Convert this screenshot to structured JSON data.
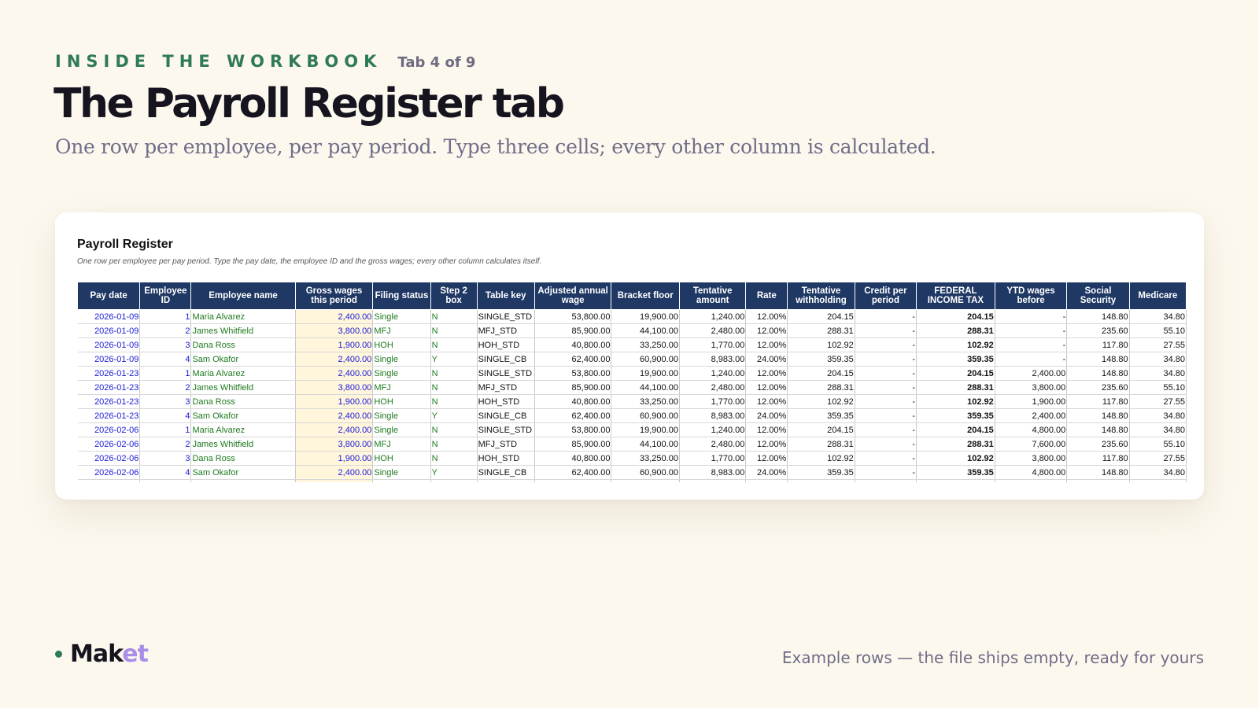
{
  "header": {
    "eyebrow": "INSIDE THE WORKBOOK",
    "tab_info": "Tab 4 of 9",
    "title": "The Payroll Register tab",
    "subtitle": "One row per employee, per pay period. Type three cells; every other column is calculated."
  },
  "sheet": {
    "title": "Payroll Register",
    "note": "One row per employee per pay period. Type the pay date, the employee ID and the gross wages; every other column calculates itself.",
    "columns": [
      "Pay date",
      "Employee ID",
      "Employee name",
      "Gross wages this period",
      "Filing status",
      "Step 2 box",
      "Table key",
      "Adjusted annual wage",
      "Bracket floor",
      "Tentative amount",
      "Rate",
      "Tentative withholding",
      "Credit per period",
      "FEDERAL INCOME TAX",
      "YTD wages before",
      "Social Security",
      "Medicare"
    ],
    "rows": [
      [
        "2026-01-09",
        "1",
        "Maria Alvarez",
        "2,400.00",
        "Single",
        "N",
        "SINGLE_STD",
        "53,800.00",
        "19,900.00",
        "1,240.00",
        "12.00%",
        "204.15",
        "-",
        "204.15",
        "-",
        "148.80",
        "34.80"
      ],
      [
        "2026-01-09",
        "2",
        "James Whitfield",
        "3,800.00",
        "MFJ",
        "N",
        "MFJ_STD",
        "85,900.00",
        "44,100.00",
        "2,480.00",
        "12.00%",
        "288.31",
        "-",
        "288.31",
        "-",
        "235.60",
        "55.10"
      ],
      [
        "2026-01-09",
        "3",
        "Dana Ross",
        "1,900.00",
        "HOH",
        "N",
        "HOH_STD",
        "40,800.00",
        "33,250.00",
        "1,770.00",
        "12.00%",
        "102.92",
        "-",
        "102.92",
        "-",
        "117.80",
        "27.55"
      ],
      [
        "2026-01-09",
        "4",
        "Sam Okafor",
        "2,400.00",
        "Single",
        "Y",
        "SINGLE_CB",
        "62,400.00",
        "60,900.00",
        "8,983.00",
        "24.00%",
        "359.35",
        "-",
        "359.35",
        "-",
        "148.80",
        "34.80"
      ],
      [
        "2026-01-23",
        "1",
        "Maria Alvarez",
        "2,400.00",
        "Single",
        "N",
        "SINGLE_STD",
        "53,800.00",
        "19,900.00",
        "1,240.00",
        "12.00%",
        "204.15",
        "-",
        "204.15",
        "2,400.00",
        "148.80",
        "34.80"
      ],
      [
        "2026-01-23",
        "2",
        "James Whitfield",
        "3,800.00",
        "MFJ",
        "N",
        "MFJ_STD",
        "85,900.00",
        "44,100.00",
        "2,480.00",
        "12.00%",
        "288.31",
        "-",
        "288.31",
        "3,800.00",
        "235.60",
        "55.10"
      ],
      [
        "2026-01-23",
        "3",
        "Dana Ross",
        "1,900.00",
        "HOH",
        "N",
        "HOH_STD",
        "40,800.00",
        "33,250.00",
        "1,770.00",
        "12.00%",
        "102.92",
        "-",
        "102.92",
        "1,900.00",
        "117.80",
        "27.55"
      ],
      [
        "2026-01-23",
        "4",
        "Sam Okafor",
        "2,400.00",
        "Single",
        "Y",
        "SINGLE_CB",
        "62,400.00",
        "60,900.00",
        "8,983.00",
        "24.00%",
        "359.35",
        "-",
        "359.35",
        "2,400.00",
        "148.80",
        "34.80"
      ],
      [
        "2026-02-06",
        "1",
        "Maria Alvarez",
        "2,400.00",
        "Single",
        "N",
        "SINGLE_STD",
        "53,800.00",
        "19,900.00",
        "1,240.00",
        "12.00%",
        "204.15",
        "-",
        "204.15",
        "4,800.00",
        "148.80",
        "34.80"
      ],
      [
        "2026-02-06",
        "2",
        "James Whitfield",
        "3,800.00",
        "MFJ",
        "N",
        "MFJ_STD",
        "85,900.00",
        "44,100.00",
        "2,480.00",
        "12.00%",
        "288.31",
        "-",
        "288.31",
        "7,600.00",
        "235.60",
        "55.10"
      ],
      [
        "2026-02-06",
        "3",
        "Dana Ross",
        "1,900.00",
        "HOH",
        "N",
        "HOH_STD",
        "40,800.00",
        "33,250.00",
        "1,770.00",
        "12.00%",
        "102.92",
        "-",
        "102.92",
        "3,800.00",
        "117.80",
        "27.55"
      ],
      [
        "2026-02-06",
        "4",
        "Sam Okafor",
        "2,400.00",
        "Single",
        "Y",
        "SINGLE_CB",
        "62,400.00",
        "60,900.00",
        "8,983.00",
        "24.00%",
        "359.35",
        "-",
        "359.35",
        "4,800.00",
        "148.80",
        "34.80"
      ]
    ]
  },
  "footer": {
    "brand_main": "Mak",
    "brand_accent": "et",
    "note": "Example rows — the file ships empty, ready for yours"
  },
  "colors": {
    "header_bg": "#1f3864",
    "input_text": "#1a1ad6",
    "lookup_text": "#1f7a1f",
    "gross_wages_fill": "#fff6dc",
    "eyebrow": "#2f7a58",
    "brand_accent": "#a98ee8"
  }
}
